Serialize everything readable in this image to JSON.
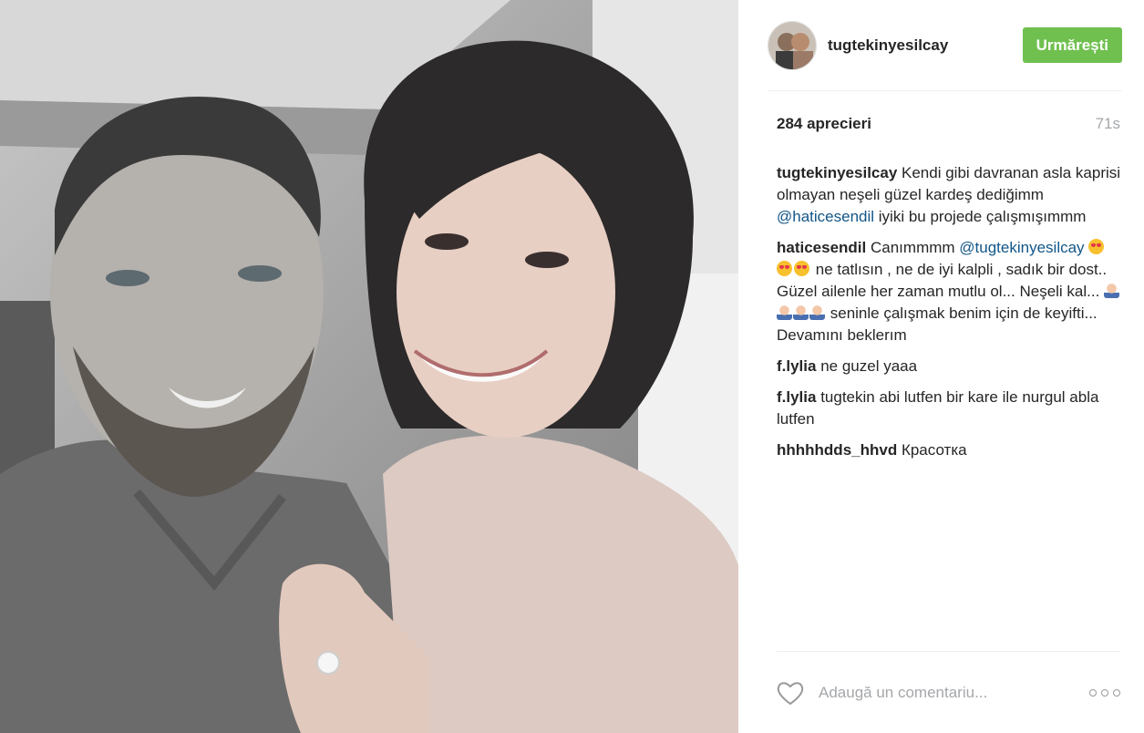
{
  "post": {
    "username": "tugtekinyesilcay",
    "follow_label": "Urmărești",
    "likes": "284 aprecieri",
    "time": "71s",
    "comments": [
      {
        "user": "tugtekinyesilcay",
        "parts": {
          "t1": "Kendi gibi davranan asla kaprisi olmayan neşeli güzel kardeş dediğimm",
          "mention": "@haticesendil",
          "t2": "iyiki bu projede çalışmışımmm"
        }
      },
      {
        "user": "haticesendil",
        "parts": {
          "t1": "Canımmmm",
          "mention": "@tugtekinyesilcay",
          "t2": "ne tatlısın , ne de iyi kalpli , sadık bir dost.. Güzel ailenle her zaman mutlu ol... Neşeli kal...",
          "t3": "seninle çalışmak benim için de keyifti... Devamını beklerım"
        }
      },
      {
        "user": "f.lylia",
        "text": "ne guzel yaaa"
      },
      {
        "user": "f.lylia",
        "text": "tugtekin abi lutfen bir kare ile nurgul abla lutfen"
      },
      {
        "user": "hhhhhdds_hhvd",
        "text": "Красотка"
      }
    ],
    "comment_placeholder": "Adaugă un comentariu...",
    "icons": {
      "like": "heart-icon",
      "more": "more-options-icon",
      "emoji_love": "heart-eyes-emoji",
      "emoji_hands": "raised-hands-emoji"
    }
  },
  "colors": {
    "follow_button": "#70c050",
    "mention": "#125688",
    "muted": "#a5a7aa"
  }
}
